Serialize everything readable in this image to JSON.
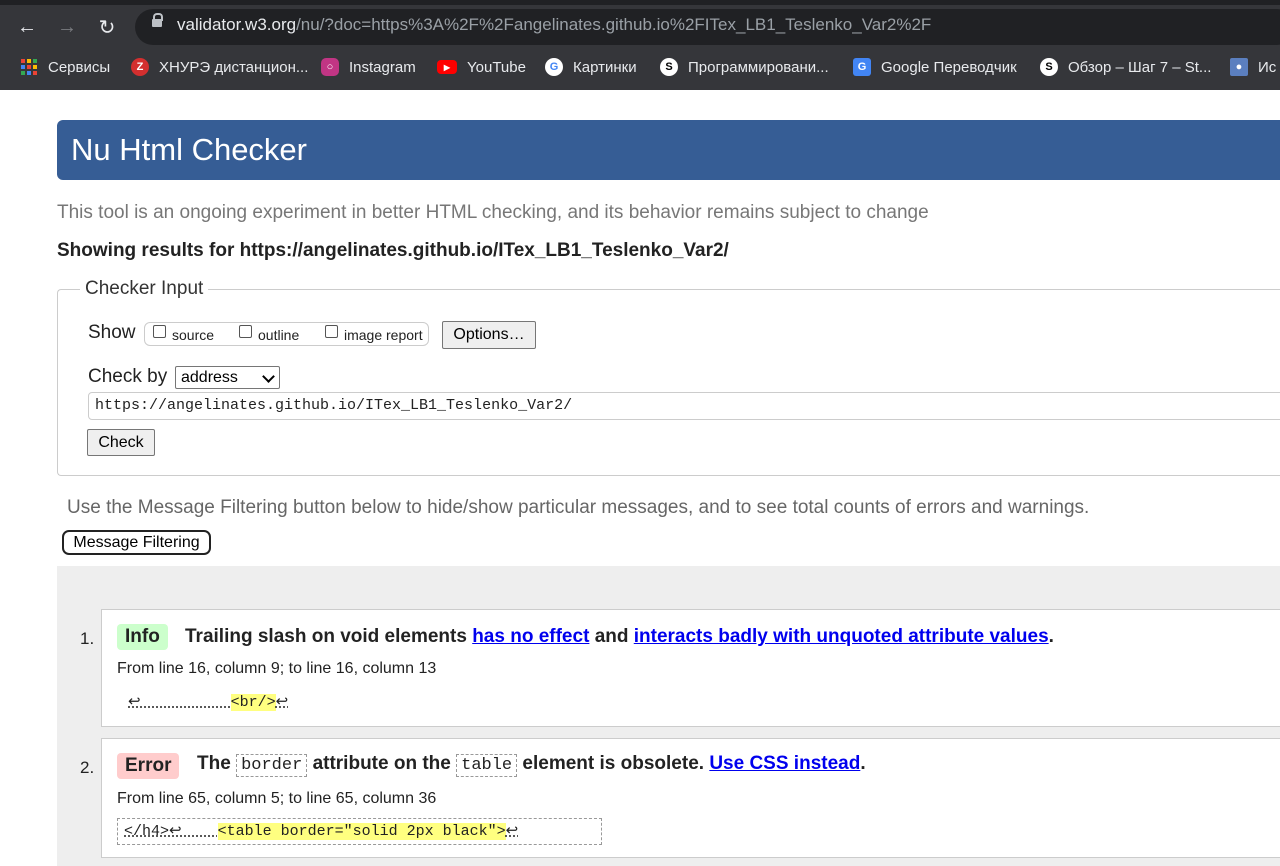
{
  "browser": {
    "url_host": "validator.w3.org",
    "url_rest": "/nu/?doc=https%3A%2F%2Fangelinates.github.io%2FITex_LB1_Teslenko_Var2%2F",
    "bookmarks": [
      {
        "label": "Сервисы",
        "icon": "apps-grid-icon"
      },
      {
        "label": "ХНУРЭ дистанцион...",
        "icon": "nure-icon"
      },
      {
        "label": "Instagram",
        "icon": "instagram-icon"
      },
      {
        "label": "YouTube",
        "icon": "youtube-icon"
      },
      {
        "label": "Картинки",
        "icon": "google-icon"
      },
      {
        "label": "Программировани...",
        "icon": "stepik-icon"
      },
      {
        "label": "Google Переводчик",
        "icon": "google-translate-icon"
      },
      {
        "label": "Обзор – Шаг 7 – St...",
        "icon": "stepik-icon"
      },
      {
        "label": "Ис",
        "icon": "site-icon"
      }
    ]
  },
  "page": {
    "title": "Nu Html Checker",
    "tagline": "This tool is an ongoing experiment in better HTML checking, and its behavior remains subject to change",
    "showing": "Showing results for https://angelinates.github.io/ITex_LB1_Teslenko_Var2/"
  },
  "checker": {
    "legend": "Checker Input",
    "show_label": "Show",
    "options": [
      "source",
      "outline",
      "image report"
    ],
    "options_button": "Options…",
    "check_by_label": "Check by",
    "check_by_value": "address",
    "url_value": "https://angelinates.github.io/ITex_LB1_Teslenko_Var2/",
    "check_button": "Check"
  },
  "filter": {
    "note": "Use the Message Filtering button below to hide/show particular messages, and to see total counts of errors and warnings.",
    "button": "Message Filtering"
  },
  "messages": [
    {
      "num": "1.",
      "type": "Info",
      "text_a": "Trailing slash on void elements",
      "link1": "has no effect",
      "text_b": "and",
      "link2": "interacts badly with unquoted attribute values",
      "text_c": ".",
      "location": "From line 16, column 9; to line 16, column 13",
      "extract_pre": "↩          ",
      "extract_hl": "<br/>",
      "extract_post": "↩"
    },
    {
      "num": "2.",
      "type": "Error",
      "text_a": "The",
      "code1": "border",
      "text_b": "attribute on the",
      "code2": "table",
      "text_c": "element is obsolete.",
      "link1": "Use CSS instead",
      "text_d": ".",
      "location": "From line 65, column 5; to line 65, column 36",
      "extract_pre": "</h4>↩    ",
      "extract_hl": "<table border=\"solid 2px black\">",
      "extract_post": "↩"
    }
  ],
  "colors": {
    "banner": "#365d95",
    "info_badge": "#ccffcc",
    "error_badge": "#ffcccc",
    "highlight": "#ffff80",
    "link": "#0000ee"
  }
}
